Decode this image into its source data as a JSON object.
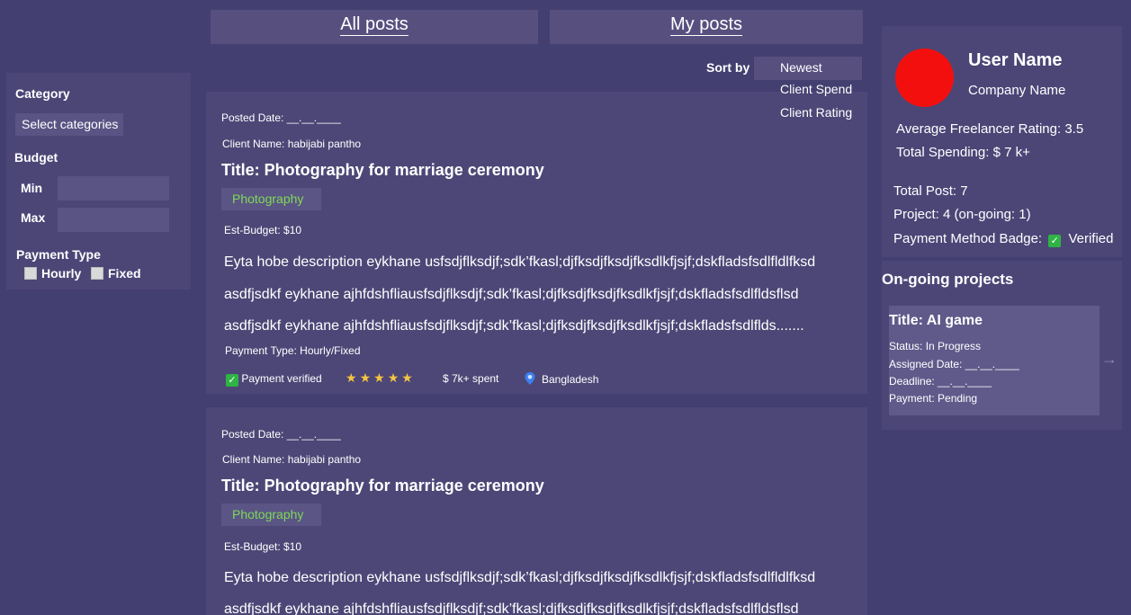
{
  "tabs": {
    "all_posts": "All posts",
    "my_posts": "My posts"
  },
  "sort": {
    "label": "Sort by",
    "options": [
      "Newest",
      "Client Spend",
      "Client Rating"
    ]
  },
  "filter": {
    "category_label": "Category",
    "category_button": "Select categories",
    "budget_label": "Budget",
    "min_label": "Min",
    "max_label": "Max",
    "payment_type_label": "Payment Type",
    "hourly_label": "Hourly",
    "fixed_label": "Fixed"
  },
  "posts": [
    {
      "posted_date": "Posted Date: __.__.____",
      "client_name": "Client Name: habijabi pantho",
      "title": "Title: Photography for marriage ceremony",
      "tag": "Photography",
      "budget": "Est-Budget: $10",
      "desc_lines": [
        "Eyta hobe description eykhane usfsdjflksdjf;sdk’fkasl;djfksdjfksdjfksdlkfjsjf;dskfladsfsdlfldlfksd",
        "asdfjsdkf eykhane ajhfdshfliausfsdjflksdjf;sdk’fkasl;djfksdjfksdjfksdlkfjsjf;dskfladsfsdlfldsflsd",
        "asdfjsdkf eykhane ajhfdshfliausfsdjflksdjf;sdk’fkasl;djfksdjfksdjfksdlkfjsjf;dskfladsfsdlflds......."
      ],
      "payment_type": "Payment Type: Hourly/Fixed",
      "payment_verified": "Payment verified",
      "rating_stars": 5,
      "spent": "$ 7k+ spent",
      "location": "Bangladesh"
    },
    {
      "posted_date": "Posted Date: __.__.____",
      "client_name": "Client Name: habijabi pantho",
      "title": "Title: Photography for marriage ceremony",
      "tag": "Photography",
      "budget": "Est-Budget: $10",
      "desc_lines": [
        "Eyta hobe description eykhane usfsdjflksdjf;sdk’fkasl;djfksdjfksdjfksdlkfjsjf;dskfladsfsdlfldlfksd",
        "asdfjsdkf eykhane ajhfdshfliausfsdjflksdjf;sdk’fkasl;djfksdjfksdjfksdlkfjsjf;dskfladsfsdlfldsflsd"
      ]
    }
  ],
  "profile": {
    "user_name": "User Name",
    "company_name": "Company Name",
    "avg_rating": "Average Freelancer Rating: 3.5",
    "total_spending": "Total Spending: $ 7 k+",
    "total_post": "Total Post: 7",
    "project": "Project: 4 (on-going: 1)",
    "payment_badge_label": "Payment Method Badge:",
    "payment_badge_value": "Verified"
  },
  "ongoing": {
    "heading": "On-going projects",
    "project": {
      "title": "Title: AI game",
      "status": "Status: In Progress",
      "assigned": "Assigned Date: __.__.____",
      "deadline": "Deadline: __.__.____",
      "payment": "Payment: Pending"
    }
  },
  "colors": {
    "background": "#433f70",
    "panel": "#4c4677",
    "tag_text": "#7ed957",
    "avatar": "#f40f0f",
    "star": "#f5c542"
  },
  "icons": {
    "check": "check-icon",
    "star": "star-icon",
    "location": "location-pin-icon",
    "next": "arrow-right-icon"
  }
}
